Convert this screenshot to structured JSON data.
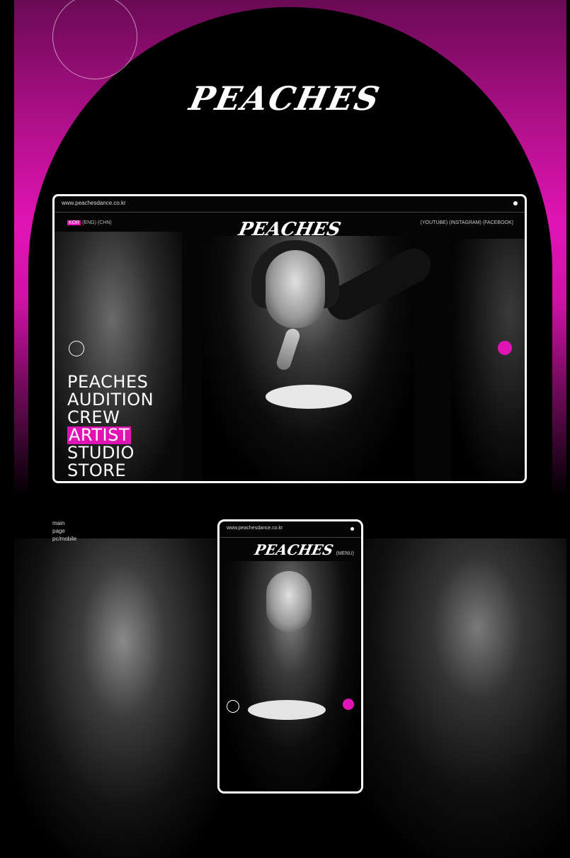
{
  "brand": {
    "logo_text": "PEACHES"
  },
  "pc": {
    "url": "www.peachesdance.co.kr",
    "languages": {
      "active": "KOR",
      "others": "(ENG) (CHN)"
    },
    "socials": "(YOUTUBE) (INSTAGRAM) (FACEBOOK)",
    "logo_text": "PEACHES",
    "menu": [
      "PEACHES",
      "AUDITION",
      "CREW",
      "ARTIST",
      "STUDIO",
      "STORE"
    ],
    "active_menu_item": "ARTIST"
  },
  "labels": {
    "line1": "main",
    "line2": "page",
    "line3": "pc/mobile"
  },
  "mobile": {
    "url": "www.peachesdance.co.kr",
    "logo_text": "PEACHES",
    "menu_label": "(MENU)"
  },
  "colors": {
    "accent": "#e014b4",
    "background": "#000000"
  }
}
